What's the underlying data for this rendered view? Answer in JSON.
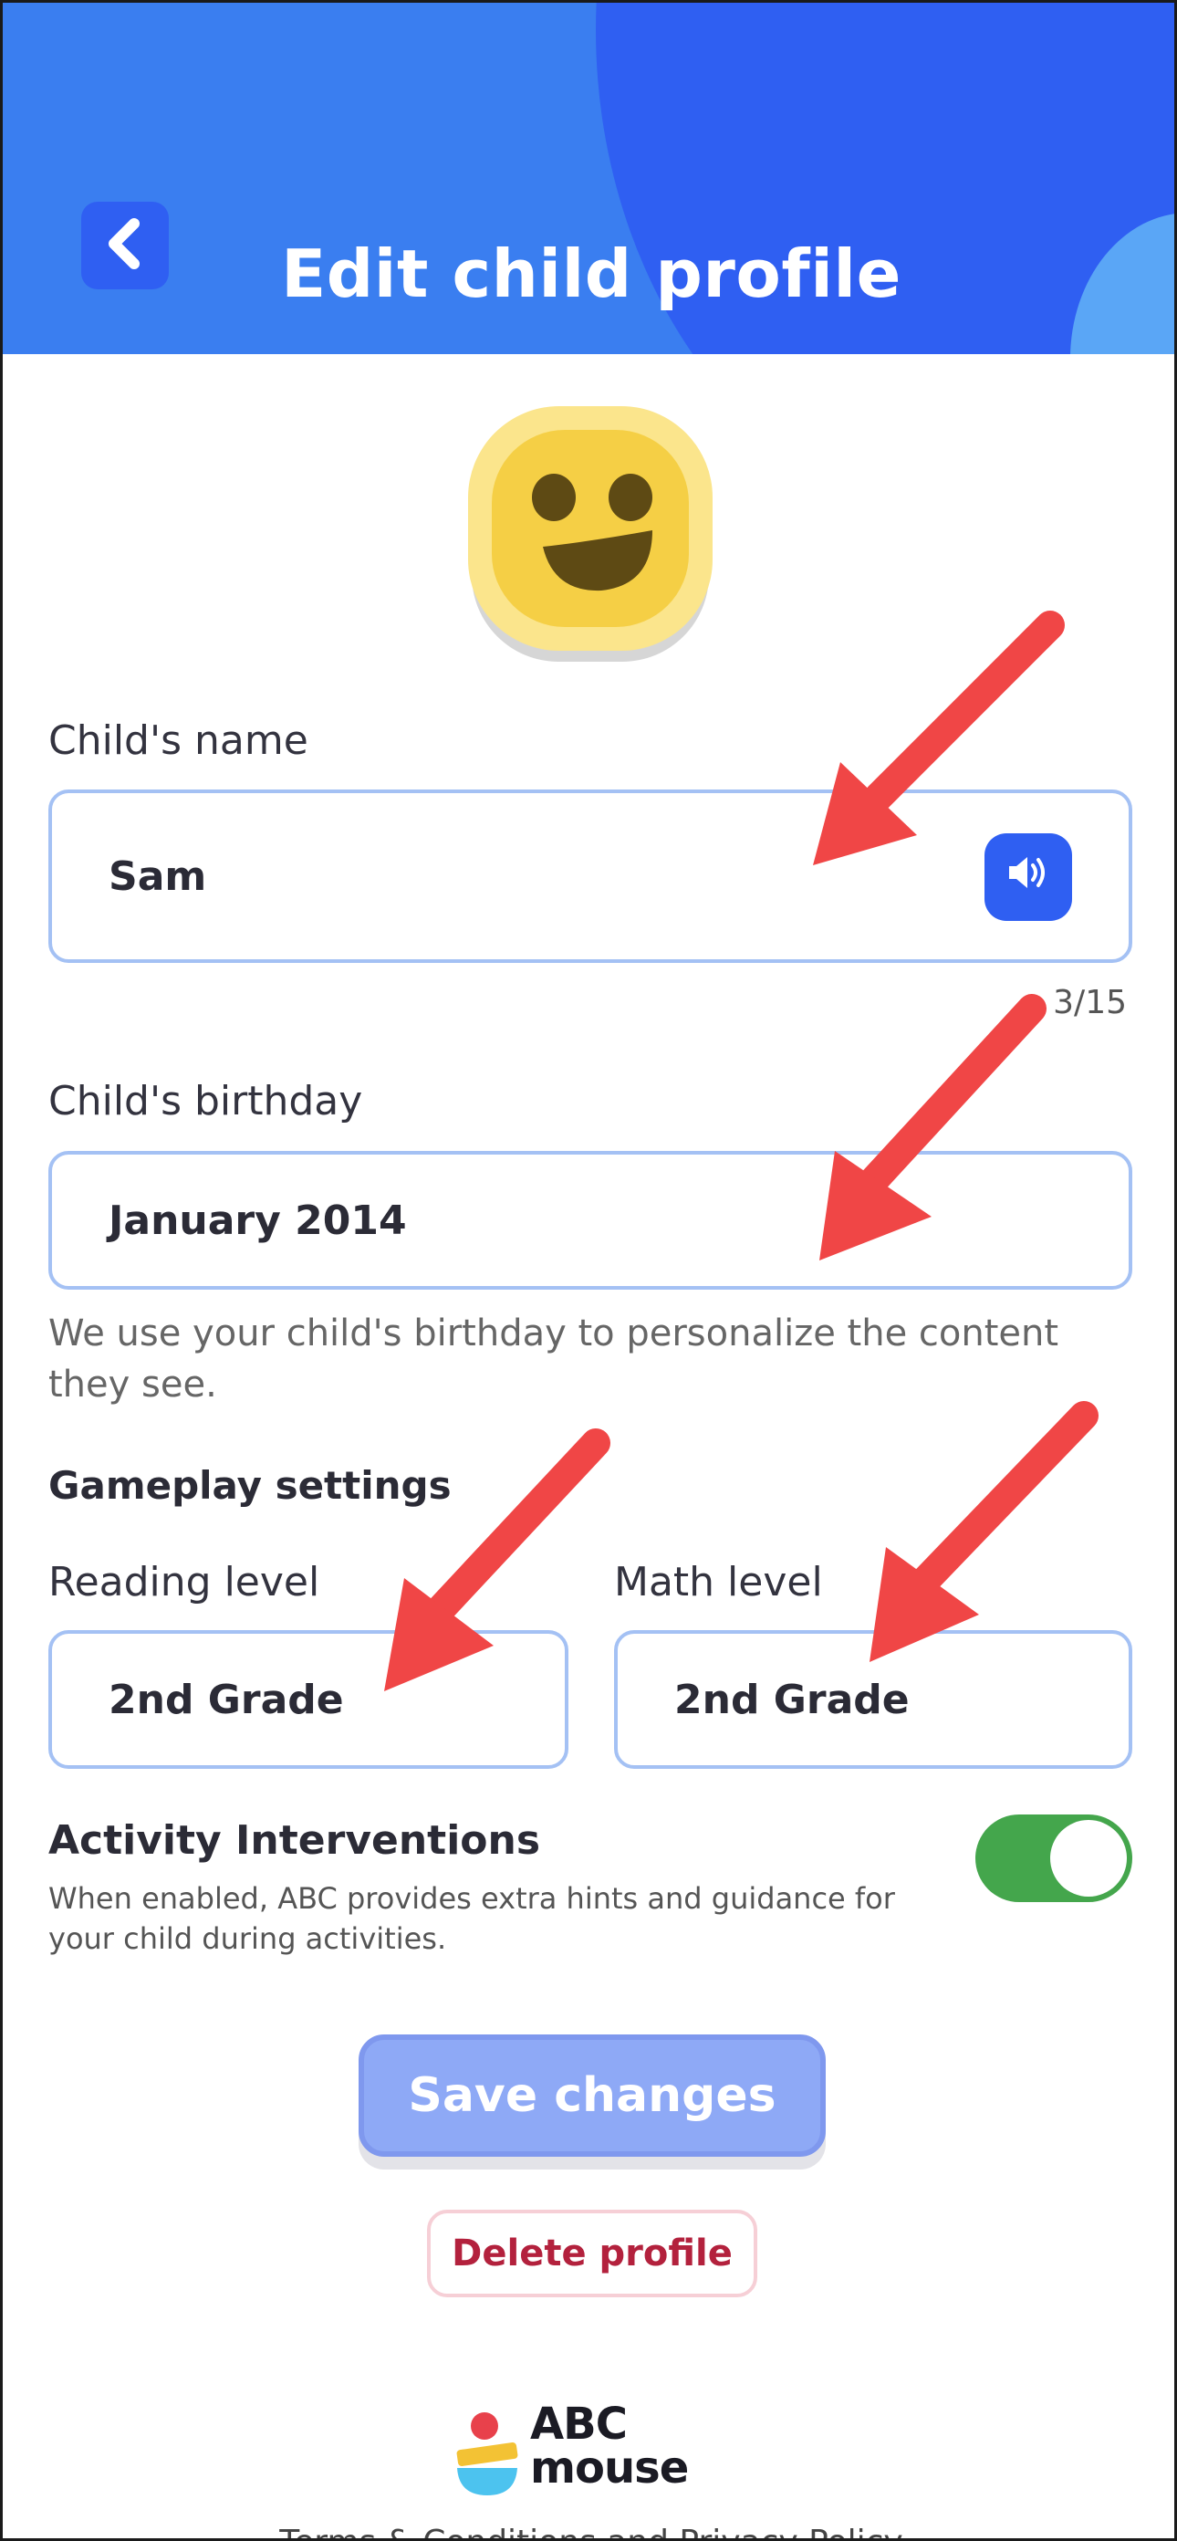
{
  "header": {
    "title": "Edit child profile",
    "back_icon": "chevron-left-icon",
    "color": "#3a7ef0"
  },
  "avatar": {
    "icon": "smiley-face-avatar",
    "color": "#f5cf45"
  },
  "name": {
    "label": "Child's name",
    "value": "Sam",
    "speaker_icon": "speaker-icon",
    "counter": "3/15"
  },
  "birthday": {
    "label": "Child's birthday",
    "value": "January 2014",
    "help": "We use your child's birthday to personalize the content they see."
  },
  "gameplay": {
    "heading": "Gameplay settings",
    "reading_label": "Reading level",
    "reading_value": "2nd Grade",
    "math_label": "Math level",
    "math_value": "2nd Grade"
  },
  "interventions": {
    "title": "Activity Interventions",
    "description": "When enabled, ABC provides extra hints and guidance for your child during activities.",
    "enabled": true,
    "toggle_color": "#44a64c"
  },
  "actions": {
    "save_label": "Save changes",
    "delete_label": "Delete profile"
  },
  "logo": {
    "line1": "ABC",
    "line2": "mouse"
  },
  "footer": {
    "text": "Terms & Conditions and Privacy Policy"
  },
  "annotation_color": "#f04646"
}
